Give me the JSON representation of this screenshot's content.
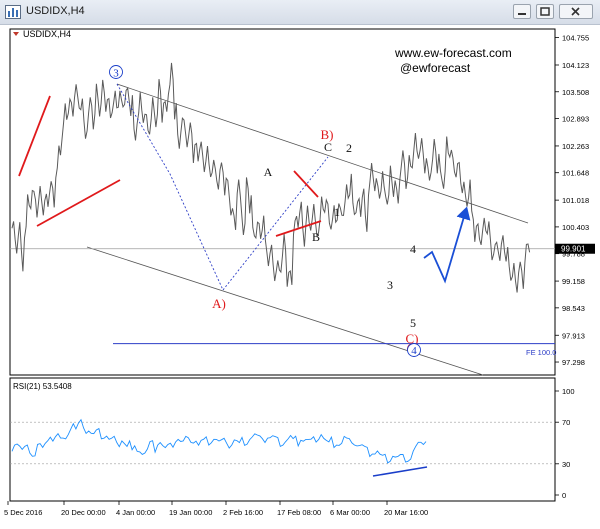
{
  "window": {
    "title": "USDIDX,H4"
  },
  "chart_data": [
    {
      "type": "line",
      "title": "USDIDX,H4",
      "watermark": [
        "www.ew-forecast.com",
        "@ewforecast"
      ],
      "ylim": [
        97.0,
        104.95
      ],
      "yticks": [
        104.755,
        104.123,
        103.508,
        102.893,
        102.263,
        101.648,
        101.018,
        100.403,
        99.788,
        99.158,
        98.543,
        97.913,
        97.298
      ],
      "ytick_labels": [
        "104.755",
        "104.123",
        "103.508",
        "102.893",
        "102.263",
        "101.648",
        "101.018",
        "100.403",
        "99.788",
        "99.158",
        "98.543",
        "97.913",
        "97.298"
      ],
      "current_price": "99.901",
      "current_price_value": 99.901,
      "fib_extension_label": "FE 100.0",
      "fib_extension_value": 97.72,
      "xtick_labels": [
        "5 Dec 2016",
        "20 Dec 00:00",
        "4 Jan 00:00",
        "19 Jan 00:00",
        "2 Feb 16:00",
        "17 Feb 08:00",
        "6 Mar 00:00",
        "20 Mar 16:00"
      ],
      "series": [
        {
          "values": [
            100.45,
            99.98,
            100.31,
            99.6,
            100.3,
            100.98,
            101.01,
            101.14,
            100.84,
            101.14,
            100.75,
            101.05,
            101.28,
            101.07,
            101.68,
            102.13,
            102.6,
            102.98,
            103.23,
            103.09,
            103.45,
            103.32,
            103.21,
            102.65,
            102.76,
            103.27,
            102.83,
            103.46,
            103.16,
            103.64,
            103.13,
            103.09,
            103.14,
            103.36,
            103.3,
            103.24,
            103.4,
            103.39,
            103.17,
            102.54,
            102.85,
            103.27,
            102.91,
            102.84,
            102.68,
            103.12,
            102.88,
            103.63,
            103.02,
            103.2,
            103.53,
            103.97,
            102.99,
            102.42,
            102.73,
            102.63,
            102.42,
            102.66,
            102.09,
            102.06,
            102.25,
            101.85,
            102.03,
            101.77,
            101.8,
            101.54,
            101.45,
            101.77,
            101.35,
            101.24,
            100.75,
            100.52,
            101.29,
            100.86,
            100.37,
            101.37,
            100.9,
            100.31,
            100.37,
            100.28,
            100.4,
            100.0,
            99.62,
            99.76,
            99.31,
            99.49,
            99.55,
            99.98,
            99.25,
            99.22,
            100.31,
            100.57,
            100.84,
            100.17,
            100.63,
            100.4,
            100.76,
            100.32,
            100.48,
            100.96,
            100.82,
            100.67,
            100.46,
            100.73,
            100.71,
            100.75,
            100.85,
            101.18,
            101.36,
            100.84,
            100.81,
            100.82,
            101.2,
            100.51,
            101.28,
            101.61,
            101.41,
            101.17,
            101.45,
            101.25,
            101.0,
            101.61,
            101.21,
            101.16,
            101.63,
            101.93,
            101.46,
            101.91,
            101.98,
            102.3,
            102.05,
            102.27,
            101.75,
            101.69,
            101.81,
            102.22,
            101.82,
            101.59,
            101.5,
            102.25,
            102.09,
            101.85,
            101.66,
            101.62,
            101.33,
            100.95,
            101.26,
            100.69,
            100.28,
            100.27,
            100.07,
            100.5,
            100.36,
            99.86,
            99.92,
            99.91,
            99.81,
            99.95,
            99.83,
            99.32,
            99.34,
            99.08,
            99.46,
            99.2,
            99.74,
            99.9
          ]
        },
        {
          "name": "RSI(21)",
          "label": "RSI(21) 53.5408",
          "ylim": [
            0,
            100
          ],
          "levels": [
            70,
            30
          ],
          "yticks": [
            100,
            70,
            30,
            0
          ],
          "values": [
            45.3,
            50.2,
            50.1,
            47.0,
            42.7,
            44.6,
            44.8,
            43.5,
            39.4,
            38.7,
            48.7,
            48.3,
            43.6,
            46.3,
            55.5,
            57.8,
            52.9,
            56.0,
            57.8,
            52.6,
            51.4,
            57.2,
            60.2,
            64.5,
            68.6,
            62.5,
            66.8,
            69.1,
            67.7,
            61.4,
            62.6,
            59.3,
            57.9,
            60.3,
            60.5,
            57.3,
            56.8,
            57.7,
            53.6,
            53.6,
            54.2,
            47.2,
            49.7,
            54.2,
            50.5,
            46.7,
            50.9,
            41.3,
            44.0,
            45.2,
            43.6,
            40.1,
            40.4,
            43.1,
            49.1,
            48.9,
            44.5,
            50.2,
            51.5,
            47.4,
            44.5,
            46.4,
            46.5,
            49.3,
            53.2,
            54.6,
            51.4,
            50.8,
            54.1,
            51.8,
            53.9,
            52.1,
            52.9,
            47.9,
            51.5,
            51.5,
            52.7,
            51.3,
            52.4,
            54.7,
            53.5,
            50.8,
            51.0,
            51.2,
            53.0,
            47.3,
            49.2,
            53.0,
            51.2,
            48.2,
            52.1,
            51.0,
            51.0,
            54.4,
            55.8,
            57.7,
            55.5,
            53.5,
            57.4,
            52.7,
            55.8,
            55.1,
            55.9,
            54.0,
            51.9,
            50.0,
            50.2,
            52.2,
            53.8,
            56.1,
            52.0,
            53.2,
            50.5,
            54.8,
            52.8,
            53.5,
            52.4,
            51.5,
            52.7,
            54.2,
            55.6,
            59.2,
            54.4,
            51.4,
            48.9,
            52.4,
            49.0,
            50.2,
            48.8,
            49.7,
            55.2,
            52.5,
            50.9,
            53.4,
            50.3,
            48.3,
            47.5,
            47.3,
            44.5,
            42.6,
            40.3,
            41.5,
            40.4,
            42.3,
            38.1,
            36.0,
            35.8,
            34.2,
            34.6,
            38.3,
            36.4,
            35.9,
            36.7,
            35.6,
            35.0,
            34.7,
            35.6,
            42.1,
            45.8,
            48.5,
            47.4,
            51.9,
            53.5
          ]
        }
      ],
      "annotations": [
        "3",
        "B)",
        "C",
        "2",
        "A",
        "1",
        "B",
        "A)",
        "4",
        "3",
        "5",
        "C)",
        "4"
      ]
    }
  ]
}
